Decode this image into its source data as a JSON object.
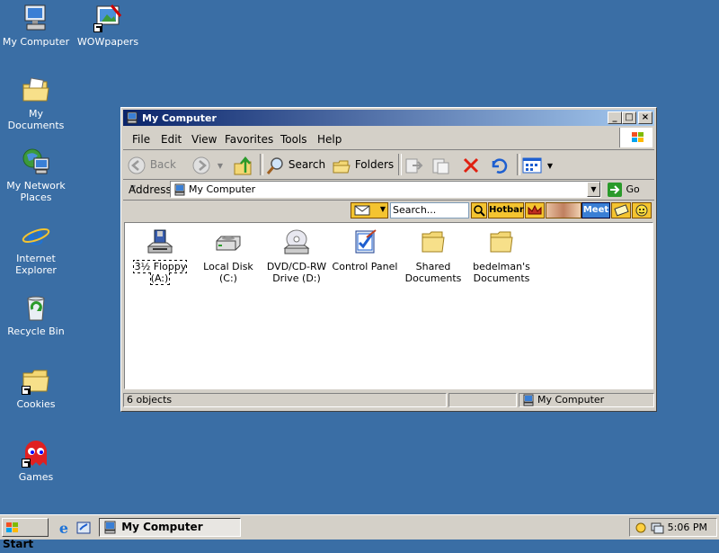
{
  "desktop": {
    "icons": [
      {
        "label": "My Computer"
      },
      {
        "label": "WOWpapers"
      },
      {
        "label": "My Documents"
      },
      {
        "label": "My Network Places"
      },
      {
        "label": "Internet Explorer"
      },
      {
        "label": "Recycle Bin"
      },
      {
        "label": "Cookies"
      },
      {
        "label": "Games"
      }
    ],
    "background_color": "#3a6ea5"
  },
  "window": {
    "title": "My Computer",
    "title_gradient": [
      "#0a246a",
      "#a6caf0"
    ],
    "controls": {
      "minimize": "_",
      "maximize": "□",
      "close": "×"
    },
    "menu": [
      "File",
      "Edit",
      "View",
      "Favorites",
      "Tools",
      "Help"
    ],
    "toolbar": {
      "back": "Back",
      "search": "Search",
      "folders": "Folders"
    },
    "address": {
      "label": "Address",
      "value": "My Computer",
      "go": "Go"
    },
    "links": {
      "search_placeholder": "Search...",
      "hotbar": "Hotbar",
      "meet": "Meet"
    },
    "items": [
      {
        "label": "3½ Floppy (A:)",
        "icon": "floppy-drive-icon"
      },
      {
        "label": "Local Disk (C:)",
        "icon": "hard-disk-icon"
      },
      {
        "label": "DVD/CD-RW Drive (D:)",
        "icon": "cd-drive-icon"
      },
      {
        "label": "Control Panel",
        "icon": "control-panel-icon"
      },
      {
        "label": "Shared Documents",
        "icon": "folder-icon"
      },
      {
        "label": "bedelman's Documents",
        "icon": "folder-icon"
      }
    ],
    "status": {
      "count": "6 objects",
      "location": "My Computer"
    }
  },
  "taskbar": {
    "start": "Start",
    "task": "My Computer",
    "clock": "5:06 PM"
  }
}
